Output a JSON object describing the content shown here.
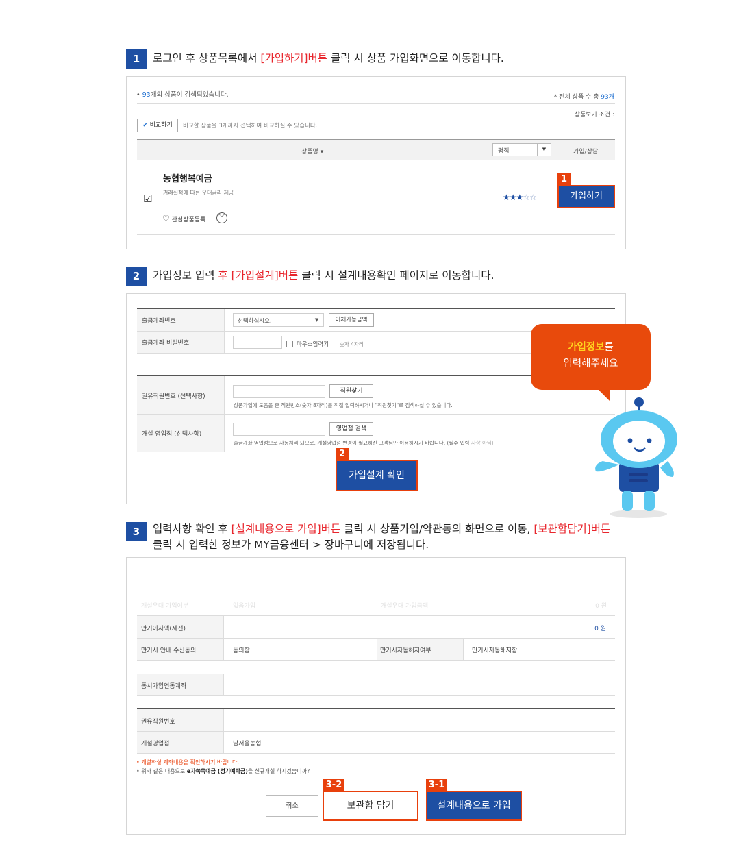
{
  "steps": [
    {
      "num": "1",
      "pre": "로그인 후 상품목록에서 ",
      "highlight": "[가입하기]버튼",
      "post": " 클릭 시 상품 가입화면으로 이동합니다."
    },
    {
      "num": "2",
      "pre": "가입정보 입력  ",
      "highlight": "후 [가입설계]버튼",
      "post": " 클릭 시 설계내용확인 페이지로 이동합니다."
    },
    {
      "num": "3",
      "pre": "입력사항 확인 후 ",
      "highlight": "[설계내용으로 가입]버튼",
      "mid": " 클릭 시 상품가입/약관동의 화면으로 이동, ",
      "highlight2": "[보관함담기]버튼",
      "line2": "클릭 시 입력한 정보가 MY금융센터 > 장바구니에 저장됩니다."
    }
  ],
  "panel1": {
    "count_prefix": "• ",
    "count_num": "93",
    "count_suffix": "개의 상품이 검색되었습니다.",
    "total_label": "* 전체 상품 수 총 ",
    "total_num": "93개",
    "view_cond": "상품보기 조건 :",
    "compare_btn": "비교하기",
    "compare_note": "비교할 상품을 3개까지 선택하여 비교하실 수 있습니다.",
    "col_name": "상품명 ▾",
    "col_rating": "평점",
    "col_join": "가입/상담",
    "product_name": "농협행복예금",
    "product_desc": "거래실적에 따른 우대금리 제공",
    "rating": 3,
    "rating_max": 5,
    "fav_label": "관심상품등록",
    "badge": "1",
    "join_btn": "가입하기"
  },
  "panel2": {
    "row1_label": "출금계좌번호",
    "row1_select": "선택하십시오.",
    "row1_btn": "이체가능금액",
    "row2_label": "출금계좌 비밀번호",
    "row2_mouse": "마우스입력기",
    "row2_hint": "숫자 4자리",
    "row3_label": "권유직원번호 (선택사항)",
    "row3_btn": "직원찾기",
    "row3_hint": "상품가입에 도움을 준 직원번호(숫자 8자리)를 직접 입력하시거나 \"직원찾기\"로 검색하실 수 있습니다.",
    "row4_label": "개설 영업점 (선택사항)",
    "row4_btn": "영업점 검색",
    "row4_hint": "출금계좌 영업점으로 자동처리 되므로, 개설영업점 변경이 필요하신 고객님만 이용하시기 바랍니다. (필수 입력 ",
    "row4_hint_gray": "사항 아님)",
    "badge": "2",
    "design_btn": "가입설계 확인",
    "bubble_hl": "가입정보",
    "bubble_l1_rest": "를",
    "bubble_l2": "입력해주세요"
  },
  "panel3": {
    "faded_row": [
      "개설우대 가입여부",
      "없음가입",
      "개설우대 가입금액",
      "0 원"
    ],
    "r1_label": "만기이자액(세전)",
    "r1_value": "0 원",
    "r2_label": "만기시 안내 수신동의",
    "r2_value": "동의함",
    "r2_label2": "만기시자동해지여부",
    "r2_value2": "만기시자동해지함",
    "r3_label": "동시가입연동계좌",
    "r4_label": "권유직원번호",
    "r5_label": "개설영업점",
    "r5_value": "남서울농협",
    "note1": "• 개설하실 계좌내용을 확인하시기 바랍니다.",
    "note2_pre": "• 위와 같은 내용으로 ",
    "note2_bold": "e자쑥쑥예금 (정기예탁금)",
    "note2_post": "을 신규개설 하시겠습니까?",
    "cancel_btn": "취소",
    "badge_keep": "3-2",
    "keep_btn": "보관함 담기",
    "badge_join": "3-1",
    "join_btn": "설계내용으로 가입"
  },
  "colors": {
    "blue": "#1e4fa3",
    "red": "#e8262d",
    "orange": "#e8400c",
    "bubble": "#e84a0c",
    "yellow": "#ffd21e",
    "robot": "#5ac8f0"
  }
}
